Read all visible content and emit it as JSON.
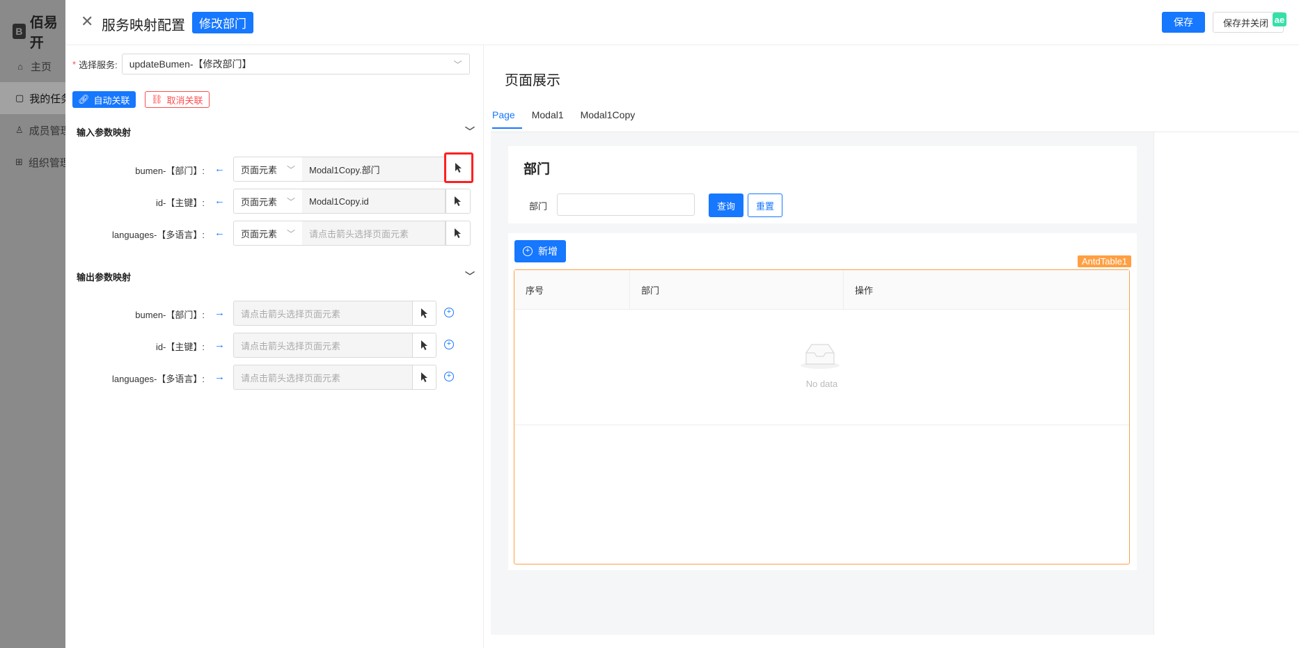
{
  "background_app": {
    "logo_text": "佰易开",
    "menu": [
      {
        "icon": "home-icon",
        "label": "主页"
      },
      {
        "icon": "file-icon",
        "label": "我的任务"
      },
      {
        "icon": "user-icon",
        "label": "成员管理"
      },
      {
        "icon": "org-icon",
        "label": "组织管理"
      }
    ]
  },
  "header": {
    "title": "服务映射配置",
    "tag": "修改部门",
    "save_label": "保存",
    "save_close_label": "保存并关闭",
    "ext_badge": "ae"
  },
  "config": {
    "service_label": "选择服务:",
    "service_value": "updateBumen-【修改部门】",
    "auto_link_label": "自动关联",
    "cancel_link_label": "取消关联",
    "input_section_title": "输入参数映射",
    "output_section_title": "输出参数映射",
    "input_rows": [
      {
        "label": "bumen-【部门】:",
        "type": "页面元素",
        "value": "Modal1Copy.部门",
        "placeholder": ""
      },
      {
        "label": "id-【主键】:",
        "type": "页面元素",
        "value": "Modal1Copy.id",
        "placeholder": ""
      },
      {
        "label": "languages-【多语言】:",
        "type": "页面元素",
        "value": "",
        "placeholder": "请点击箭头选择页面元素"
      }
    ],
    "output_rows": [
      {
        "label": "bumen-【部门】:",
        "placeholder": "请点击箭头选择页面元素"
      },
      {
        "label": "id-【主键】:",
        "placeholder": "请点击箭头选择页面元素"
      },
      {
        "label": "languages-【多语言】:",
        "placeholder": "请点击箭头选择页面元素"
      }
    ]
  },
  "preview": {
    "title": "页面展示",
    "tabs": [
      "Page",
      "Modal1",
      "Modal1Copy"
    ],
    "active_tab": "Page",
    "search_card_title": "部门",
    "search_label": "部门",
    "query_label": "查询",
    "reset_label": "重置",
    "add_label": "新增",
    "component_tag": "AntdTable1",
    "columns": [
      "序号",
      "部门",
      "操作"
    ],
    "empty_text": "No data"
  },
  "colors": {
    "primary": "#1677ff",
    "danger": "#ff4d4f",
    "highlight_border": "#ff1f1f",
    "component_outline": "#ff9f43"
  }
}
